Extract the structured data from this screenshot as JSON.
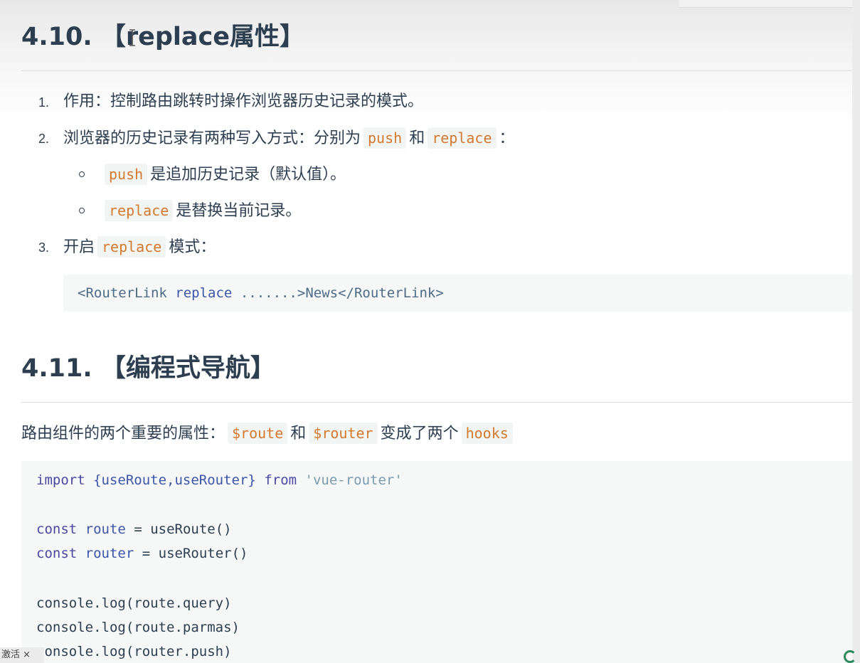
{
  "section1": {
    "title": "4.10. 【replace属性】",
    "items": [
      {
        "num": "1.",
        "text": "作用：控制路由跳转时操作浏览器历史记录的模式。"
      },
      {
        "num": "2.",
        "text_before": "浏览器的历史记录有两种写入方式：分别为",
        "code1": "push",
        "mid": "和",
        "code2": "replace",
        "text_after": "："
      },
      {
        "num": "3.",
        "text_before": "开启",
        "code": "replace",
        "text_after": "模式："
      }
    ],
    "subitems": [
      {
        "code": "push",
        "text": "是追加历史记录（默认值）。"
      },
      {
        "code": "replace",
        "text": "是替换当前记录。"
      }
    ],
    "code_block": {
      "open_tag": "<RouterLink",
      "attr": "replace",
      "rest": ".......>News</RouterLink>"
    }
  },
  "section2": {
    "title": "4.11. 【编程式导航】",
    "intro": {
      "text_before": "路由组件的两个重要的属性：",
      "code1": "$route",
      "mid": "和",
      "code2": "$router",
      "text_mid2": "变成了两个",
      "code3": "hooks"
    },
    "code": {
      "import_kw": "import",
      "import_names": "{useRoute,useRouter}",
      "from_kw": "from",
      "module": "'vue-router'",
      "const_kw": "const",
      "route_var": "route",
      "route_rhs": "= useRoute()",
      "router_var": "router",
      "router_rhs": "= useRouter()",
      "log1": "console.log(route.query)",
      "log2": "console.log(route.parmas)",
      "log3": "console.log(router.push)"
    }
  },
  "overlay": {
    "badge": "激活 ×"
  },
  "colors": {
    "inline_code": "#d27a2e",
    "heading": "#2c3e50",
    "code_bg": "#f6f7f7"
  }
}
